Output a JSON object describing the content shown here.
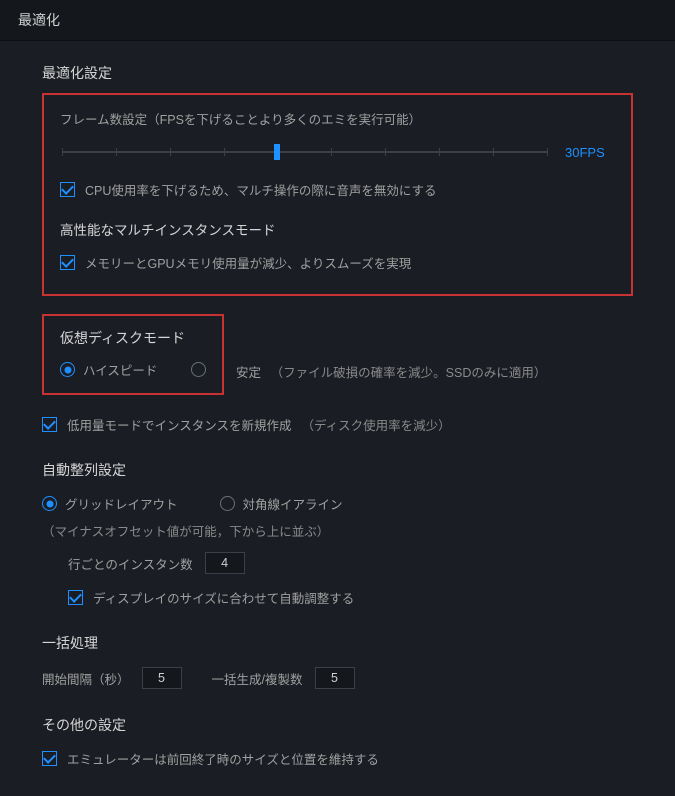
{
  "titlebar": "最適化",
  "optimization": {
    "title": "最適化設定",
    "frame_label": "フレーム数設定（FPSを下げることより多くのエミを実行可能）",
    "fps_value": "30FPS",
    "mute_label": "CPU使用率を下げるため、マルチ操作の際に音声を無効にする",
    "perf_mode_title": "高性能なマルチインスタンスモード",
    "perf_mode_label": "メモリーとGPUメモリ使用量が減少、よりスムーズを実現"
  },
  "disk": {
    "title": "仮想ディスクモード",
    "hispeed": "ハイスピード",
    "stable": "安定",
    "stable_note": "（ファイル破損の確率を減少。SSDのみに適用）",
    "low_usage_label": "低用量モードでインスタンスを新規作成",
    "low_usage_note": "（ディスク使用率を減少）"
  },
  "align": {
    "title": "自動整列設定",
    "grid": "グリッドレイアウト",
    "diagonal": "対角線イアライン",
    "diagonal_note": "（マイナスオフセット値が可能，下から上に並ぶ）",
    "per_row_label": "行ごとのインスタン数",
    "per_row_value": "4",
    "autofit_label": "ディスプレイのサイズに合わせて自動調整する"
  },
  "batch": {
    "title": "一括処理",
    "interval_label": "開始間隔（秒）",
    "interval_value": "5",
    "count_label": "一括生成/複製数",
    "count_value": "5"
  },
  "other": {
    "title": "その他の設定",
    "remember_label": "エミュレーターは前回終了時のサイズと位置を維持する"
  }
}
